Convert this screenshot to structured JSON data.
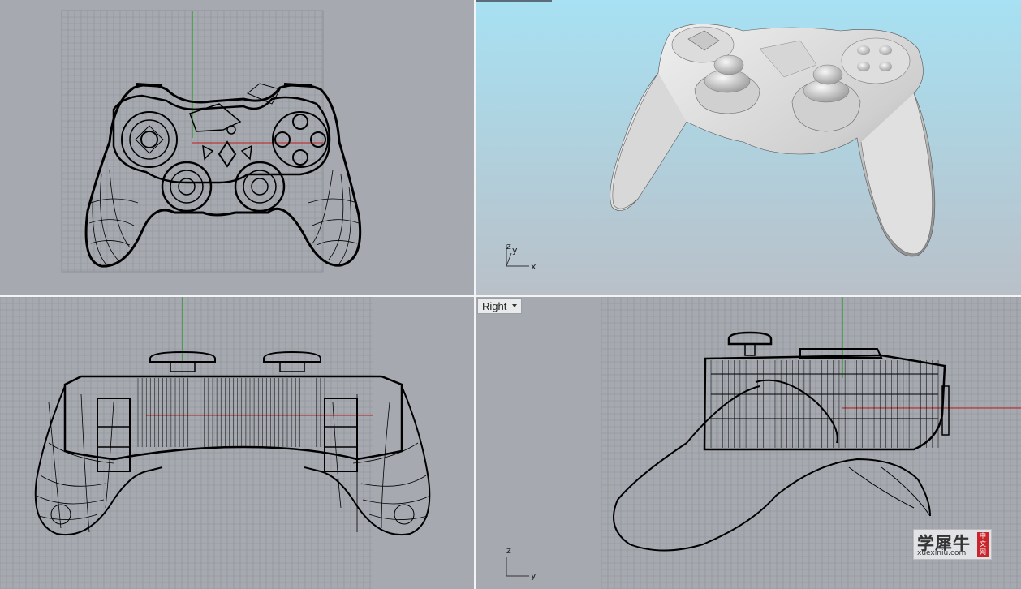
{
  "viewports": {
    "top": {
      "name": "",
      "background": "#a6aab0"
    },
    "perspective": {
      "name": "",
      "background_top": "#a9def0",
      "background_bottom": "#b8c0c8"
    },
    "front": {
      "name": "",
      "background": "#a6aab0"
    },
    "right": {
      "name": "Right",
      "background": "#a6aab0"
    }
  },
  "axes": {
    "perspective": {
      "z": "z",
      "y": "y",
      "x": "x"
    },
    "right": {
      "z": "z",
      "y": "y"
    }
  },
  "colors": {
    "grid_line": "#8c9096",
    "grid_major": "#7e8288",
    "y_axis": "#1fa01f",
    "x_axis": "#c01818",
    "wire": "#000000",
    "shaded": "#e6e6e6"
  },
  "icons": {
    "dropdown": "chevron-down-icon"
  },
  "watermark": {
    "text": "学犀牛",
    "url": "xuexiniu.com",
    "seal": "中文网"
  }
}
